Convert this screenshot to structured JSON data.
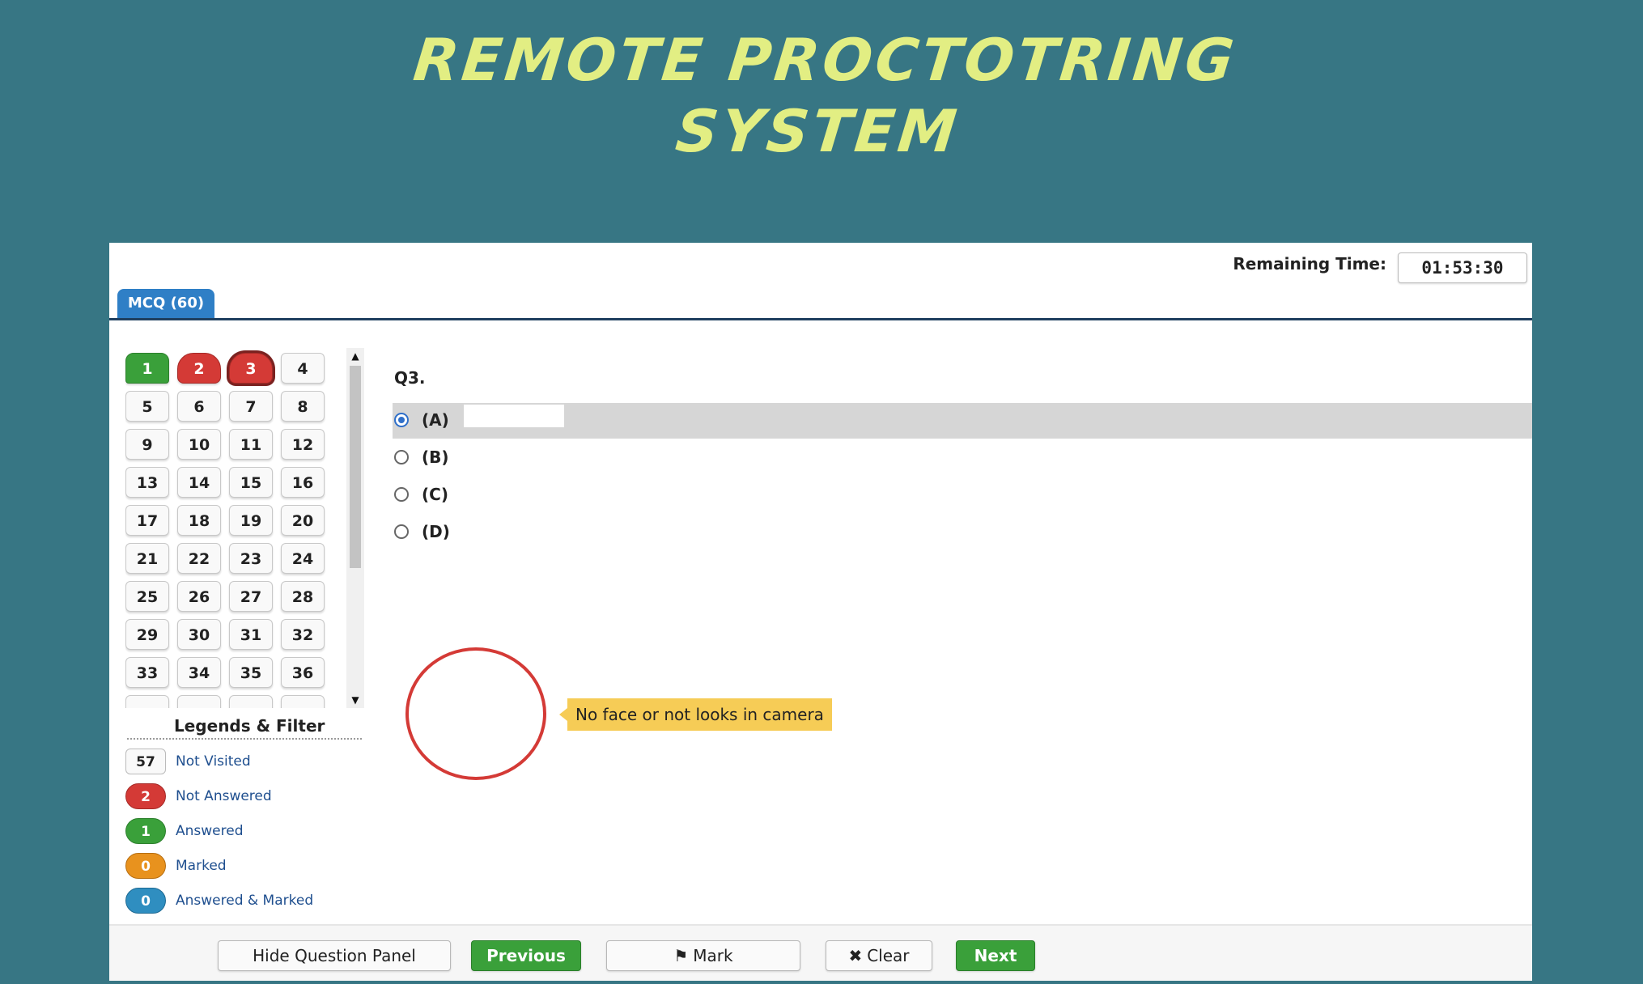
{
  "hero": {
    "line1": "REMOTE PROCTOTRING",
    "line2": "SYSTEM"
  },
  "colors": {
    "background": "#377684",
    "title": "#E2EE83",
    "answered": "#3aa03a",
    "not_answered": "#d43a36",
    "marked": "#e8921e",
    "answered_marked": "#2f8ec0",
    "tooltip": "#f6cc56"
  },
  "header": {
    "remaining_label": "Remaining Time:",
    "timer": "01:53:30",
    "section_tab": "MCQ (60)"
  },
  "palette": {
    "questions": [
      {
        "label": "1",
        "state": "answered"
      },
      {
        "label": "2",
        "state": "not-answered"
      },
      {
        "label": "3",
        "state": "not-answered-current"
      },
      {
        "label": "4",
        "state": "not-visited"
      },
      {
        "label": "5",
        "state": "not-visited"
      },
      {
        "label": "6",
        "state": "not-visited"
      },
      {
        "label": "7",
        "state": "not-visited"
      },
      {
        "label": "8",
        "state": "not-visited"
      },
      {
        "label": "9",
        "state": "not-visited"
      },
      {
        "label": "10",
        "state": "not-visited"
      },
      {
        "label": "11",
        "state": "not-visited"
      },
      {
        "label": "12",
        "state": "not-visited"
      },
      {
        "label": "13",
        "state": "not-visited"
      },
      {
        "label": "14",
        "state": "not-visited"
      },
      {
        "label": "15",
        "state": "not-visited"
      },
      {
        "label": "16",
        "state": "not-visited"
      },
      {
        "label": "17",
        "state": "not-visited"
      },
      {
        "label": "18",
        "state": "not-visited"
      },
      {
        "label": "19",
        "state": "not-visited"
      },
      {
        "label": "20",
        "state": "not-visited"
      },
      {
        "label": "21",
        "state": "not-visited"
      },
      {
        "label": "22",
        "state": "not-visited"
      },
      {
        "label": "23",
        "state": "not-visited"
      },
      {
        "label": "24",
        "state": "not-visited"
      },
      {
        "label": "25",
        "state": "not-visited"
      },
      {
        "label": "26",
        "state": "not-visited"
      },
      {
        "label": "27",
        "state": "not-visited"
      },
      {
        "label": "28",
        "state": "not-visited"
      },
      {
        "label": "29",
        "state": "not-visited"
      },
      {
        "label": "30",
        "state": "not-visited"
      },
      {
        "label": "31",
        "state": "not-visited"
      },
      {
        "label": "32",
        "state": "not-visited"
      },
      {
        "label": "33",
        "state": "not-visited"
      },
      {
        "label": "34",
        "state": "not-visited"
      },
      {
        "label": "35",
        "state": "not-visited"
      },
      {
        "label": "36",
        "state": "not-visited"
      },
      {
        "label": "",
        "state": "not-visited"
      },
      {
        "label": "",
        "state": "not-visited"
      },
      {
        "label": "",
        "state": "not-visited"
      },
      {
        "label": "",
        "state": "not-visited"
      }
    ],
    "scroll_up_icon": "triangle-up-icon",
    "scroll_down_icon": "triangle-down-icon"
  },
  "legend": {
    "title": "Legends & Filter",
    "items": [
      {
        "count": "57",
        "label": "Not Visited",
        "state": "not-visited"
      },
      {
        "count": "2",
        "label": "Not Answered",
        "state": "not-answered"
      },
      {
        "count": "1",
        "label": "Answered",
        "state": "answered"
      },
      {
        "count": "0",
        "label": "Marked",
        "state": "marked"
      },
      {
        "count": "0",
        "label": "Answered & Marked",
        "state": "answered-marked"
      }
    ]
  },
  "question": {
    "number": "Q3.",
    "options": [
      {
        "label": "(A)",
        "selected": true
      },
      {
        "label": "(B)",
        "selected": false
      },
      {
        "label": "(C)",
        "selected": false
      },
      {
        "label": "(D)",
        "selected": false
      }
    ]
  },
  "proctor": {
    "alert": "No face or not looks in camera"
  },
  "footer": {
    "hide_panel": "Hide Question Panel",
    "previous": "Previous",
    "mark": "Mark",
    "mark_icon": "bookmark-icon",
    "clear": "Clear",
    "clear_icon": "x-icon",
    "next": "Next"
  }
}
